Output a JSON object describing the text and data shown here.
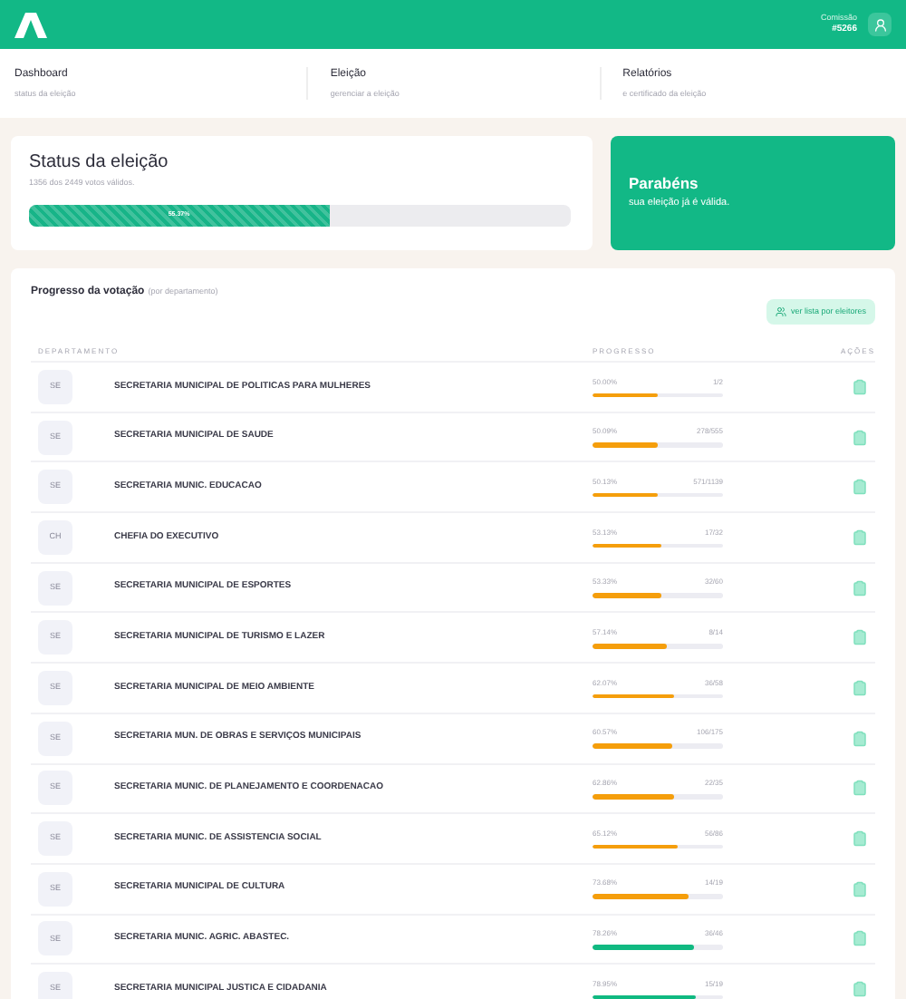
{
  "header": {
    "label": "Comissão",
    "code": "#5266"
  },
  "nav": [
    {
      "title": "Dashboard",
      "subtitle": "status da eleição"
    },
    {
      "title": "Eleição",
      "subtitle": "gerenciar a eleição"
    },
    {
      "title": "Relatórios",
      "subtitle": "e certificado da eleição"
    }
  ],
  "status": {
    "title": "Status da eleição",
    "subtitle": "1356 dos 2449 votos válidos.",
    "level": 0.5537,
    "reading": "55.37%"
  },
  "congrats": {
    "title": "Parabéns",
    "text": "sua eleição já é válida."
  },
  "progress": {
    "title": "Progresso da votação",
    "note": "(por departamento)",
    "button": "ver lista por eleitores",
    "columns": [
      "DEPARTAMENTO",
      "PROGRESSO",
      "AÇÕES"
    ],
    "rows": [
      {
        "initials": "SE",
        "name": "SECRETARIA MUNICIPAL DE POLITICAS PARA MULHERES",
        "percent": "50.00%",
        "count": "1/2",
        "level": 0.5,
        "color": "#f59e0b"
      },
      {
        "initials": "SE",
        "name": "SECRETARIA MUNICIPAL DE SAUDE",
        "percent": "50.09%",
        "count": "278/555",
        "level": 0.5009,
        "color": "#f59e0b"
      },
      {
        "initials": "SE",
        "name": "SECRETARIA MUNIC. EDUCACAO",
        "percent": "50.13%",
        "count": "571/1139",
        "level": 0.5013,
        "color": "#f59e0b"
      },
      {
        "initials": "CH",
        "name": "CHEFIA DO EXECUTIVO",
        "percent": "53.13%",
        "count": "17/32",
        "level": 0.5313,
        "color": "#f59e0b"
      },
      {
        "initials": "SE",
        "name": "SECRETARIA MUNICIPAL DE ESPORTES",
        "percent": "53.33%",
        "count": "32/60",
        "level": 0.5333,
        "color": "#f59e0b"
      },
      {
        "initials": "SE",
        "name": "SECRETARIA MUNICIPAL DE TURISMO E LAZER",
        "percent": "57.14%",
        "count": "8/14",
        "level": 0.5714,
        "color": "#f59e0b"
      },
      {
        "initials": "SE",
        "name": "SECRETARIA MUNICIPAL DE MEIO AMBIENTE",
        "percent": "62.07%",
        "count": "36/58",
        "level": 0.6207,
        "color": "#f59e0b"
      },
      {
        "initials": "SE",
        "name": "SECRETARIA MUN. DE OBRAS E SERVIÇOS MUNICIPAIS",
        "percent": "60.57%",
        "count": "106/175",
        "level": 0.6057,
        "color": "#f59e0b"
      },
      {
        "initials": "SE",
        "name": "SECRETARIA MUNIC. DE PLANEJAMENTO E COORDENACAO",
        "percent": "62.86%",
        "count": "22/35",
        "level": 0.6286,
        "color": "#f59e0b"
      },
      {
        "initials": "SE",
        "name": "SECRETARIA MUNIC. DE ASSISTENCIA SOCIAL",
        "percent": "65.12%",
        "count": "56/86",
        "level": 0.6512,
        "color": "#f59e0b"
      },
      {
        "initials": "SE",
        "name": "SECRETARIA MUNICIPAL DE CULTURA",
        "percent": "73.68%",
        "count": "14/19",
        "level": 0.7368,
        "color": "#f59e0b"
      },
      {
        "initials": "SE",
        "name": "SECRETARIA MUNIC. AGRIC. ABASTEC.",
        "percent": "78.26%",
        "count": "36/46",
        "level": 0.7826,
        "color": "#10b981"
      },
      {
        "initials": "SE",
        "name": "SECRETARIA MUNICIPAL JUSTICA E CIDADANIA",
        "percent": "78.95%",
        "count": "15/19",
        "level": 0.7895,
        "color": "#10b981"
      }
    ]
  }
}
